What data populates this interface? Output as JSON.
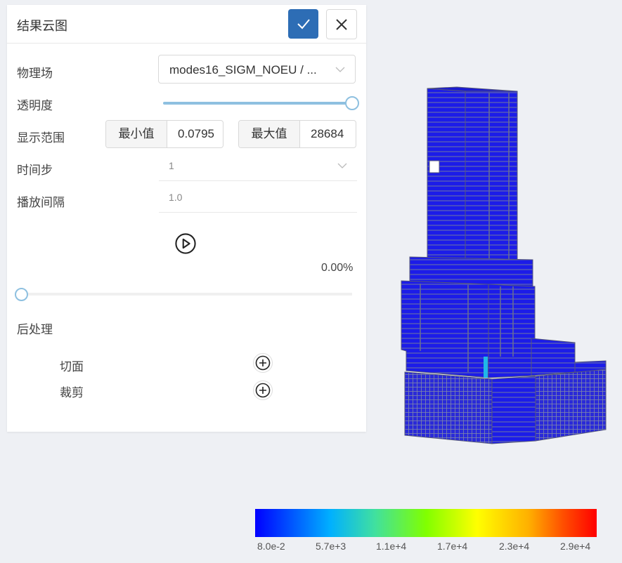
{
  "panel": {
    "title": "结果云图",
    "physics_label": "物理场",
    "physics_value": "modes16_SIGM_NOEU / ...",
    "opacity_label": "透明度",
    "opacity_value": 1.0,
    "range_label": "显示范围",
    "min_label": "最小值",
    "min_value": "0.0795",
    "max_label": "最大值",
    "max_value": "28684",
    "timestep_label": "时间步",
    "timestep_value": "1",
    "interval_label": "播放间隔",
    "interval_value": "1.0",
    "progress_text": "0.00%",
    "progress_value": 0.0,
    "postprocess_label": "后处理",
    "section_label": "切面",
    "clip_label": "裁剪"
  },
  "colors": {
    "confirm_button": "#2d6db5",
    "slider": "#8ec0e0",
    "model_fill": "#1a1aee",
    "model_edge": "#6a7090"
  },
  "legend": {
    "ticks": [
      "8.0e-2",
      "5.7e+3",
      "1.1e+4",
      "1.7e+4",
      "2.3e+4",
      "2.9e+4"
    ],
    "colormap": [
      "#0000ff",
      "#00b0ff",
      "#80ff00",
      "#ffff00",
      "#ffb000",
      "#ff0000"
    ]
  }
}
